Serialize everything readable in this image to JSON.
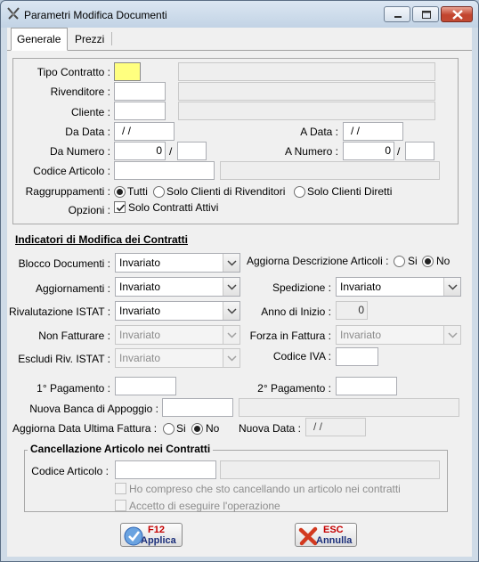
{
  "window": {
    "title": "Parametri Modifica Documenti"
  },
  "tabs": [
    {
      "label": "Generale"
    },
    {
      "label": "Prezzi"
    }
  ],
  "filters": {
    "tipo_contratto_label": "Tipo Contratto :",
    "rivenditore_label": "Rivenditore :",
    "cliente_label": "Cliente :",
    "da_data_label": "Da Data :",
    "da_data_value": "/ /",
    "a_data_label": "A Data :",
    "a_data_value": "/ /",
    "da_numero_label": "Da Numero :",
    "da_numero_value": "0",
    "a_numero_label": "A Numero :",
    "a_numero_value": "0",
    "slash": "/",
    "codice_articolo_label": "Codice Articolo :",
    "raggruppamenti_label": "Raggruppamenti :",
    "raggruppamenti_options": [
      "Tutti",
      "Solo Clienti di Rivenditori",
      "Solo Clienti Diretti"
    ],
    "raggruppamenti_selected": "Tutti",
    "opzioni_label": "Opzioni :",
    "solo_contratti_attivi_label": "Solo Contratti Attivi",
    "solo_contratti_attivi_checked": true
  },
  "indicators": {
    "section_title": "Indicatori di Modifica dei Contratti",
    "blocco_documenti_label": "Blocco Documenti :",
    "blocco_documenti_value": "Invariato",
    "aggiorna_descrizione_label": "Aggiorna Descrizione Articoli :",
    "aggiorna_descrizione_si": "Si",
    "aggiorna_descrizione_no": "No",
    "aggiorna_descrizione_selected": "No",
    "aggiornamenti_label": "Aggiornamenti :",
    "aggiornamenti_value": "Invariato",
    "spedizione_label": "Spedizione :",
    "spedizione_value": "Invariato",
    "rivalutazione_label": "Rivalutazione ISTAT :",
    "rivalutazione_value": "Invariato",
    "anno_inizio_label": "Anno di Inizio :",
    "anno_inizio_value": "0",
    "non_fatturare_label": "Non Fatturare :",
    "non_fatturare_value": "Invariato",
    "forza_fattura_label": "Forza in Fattura :",
    "forza_fattura_value": "Invariato",
    "escludi_istat_label": "Escludi Riv. ISTAT :",
    "escludi_istat_value": "Invariato",
    "codice_iva_label": "Codice IVA :",
    "primo_pagamento_label": "1° Pagamento :",
    "secondo_pagamento_label": "2° Pagamento :",
    "nuova_banca_label": "Nuova Banca di Appoggio :",
    "aggiorna_data_label": "Aggiorna Data Ultima Fattura :",
    "aggiorna_data_si": "Si",
    "aggiorna_data_no": "No",
    "aggiorna_data_selected": "No",
    "nuova_data_label": "Nuova Data :",
    "nuova_data_value": "/ /"
  },
  "cancellazione": {
    "title": "Cancellazione Articolo nei Contratti",
    "codice_articolo_label": "Codice Articolo :",
    "confirm1_label": "Ho compreso che sto cancellando un articolo nei contratti",
    "confirm2_label": "Accetto di eseguire l'operazione"
  },
  "buttons": {
    "apply_key": "F12",
    "apply_label": "Applica",
    "cancel_key": "ESC",
    "cancel_label": "Annulla"
  },
  "colors": {
    "focus_field": "#ffff7f",
    "titlebar": "#c8d7e8",
    "close_button": "#c24a34"
  }
}
